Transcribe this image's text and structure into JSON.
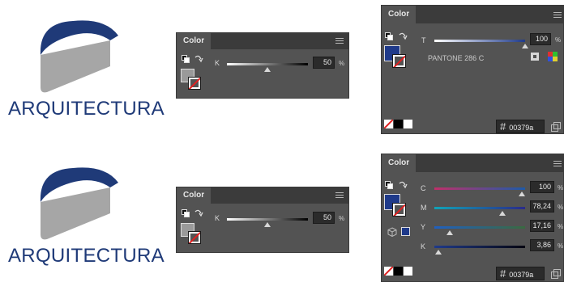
{
  "logos": [
    {
      "text": "ARQUITECTURA",
      "colors": {
        "dark": "#1f3a78",
        "gray": "#a6a6a6"
      }
    },
    {
      "text": "ARQUITECTURA",
      "colors": {
        "dark": "#1f3a78",
        "gray": "#a6a6a6"
      }
    }
  ],
  "gray_panels": [
    {
      "tab": "Color",
      "channel_label": "K",
      "value": "50",
      "unit": "%",
      "slider_level": 0.5,
      "fill_color": "#9a9a9a"
    },
    {
      "tab": "Color",
      "channel_label": "K",
      "value": "50",
      "unit": "%",
      "slider_level": 0.5,
      "fill_color": "#9a9a9a"
    }
  ],
  "pantone_panel": {
    "tab": "Color",
    "channel_label": "T",
    "value": "100",
    "unit": "%",
    "slider_level": 1.0,
    "swatch_name": "PANTONE 286 C",
    "hex": "00379a",
    "fill_color": "#1f3a8a"
  },
  "cmyk_panel": {
    "tab": "Color",
    "fill_color": "#1f3a8a",
    "hex": "00379a",
    "channels": [
      {
        "label": "C",
        "value": "100",
        "unit": "%",
        "level": 1.0
      },
      {
        "label": "M",
        "value": "78,24",
        "unit": "%",
        "level": 0.78
      },
      {
        "label": "Y",
        "value": "17,16",
        "unit": "%",
        "level": 0.17
      },
      {
        "label": "K",
        "value": "3,86",
        "unit": "%",
        "level": 0.04
      }
    ]
  }
}
